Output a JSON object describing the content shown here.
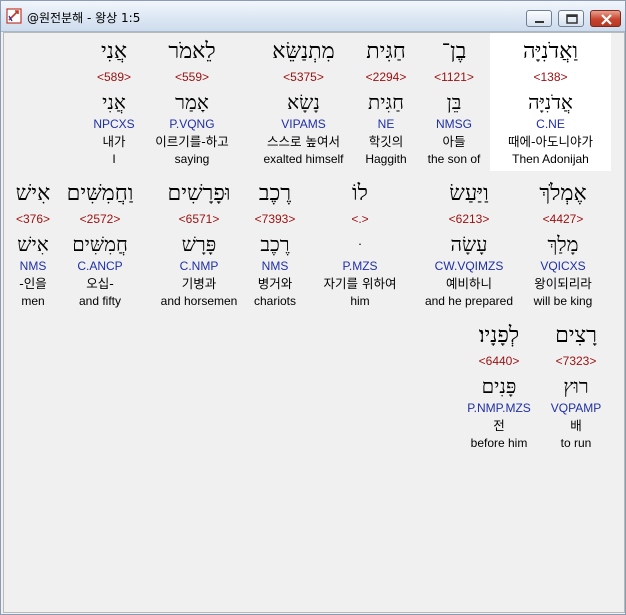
{
  "window": {
    "title": "@원전분해 - 왕상 1:5"
  },
  "rows": [
    [
      {
        "heb": "אֲנִי",
        "strong": "<589>",
        "lemma": "אֲנִי",
        "parse": "NPCXS",
        "kor": "내가",
        "eng": "I",
        "hl": false
      },
      {
        "heb": "לֵאמֹר",
        "strong": "<559>",
        "lemma": "אָמַר",
        "parse": "P.VQNG",
        "kor": "이르기를-하고",
        "eng": "saying",
        "hl": false
      },
      {
        "heb": "מִתְנַשֵּׂא",
        "strong": "<5375>",
        "lemma": "נָשָׂא",
        "parse": "VIPAMS",
        "kor": "스스로 높여서",
        "eng": "exalted himself",
        "hl": false
      },
      {
        "heb": "חַגִּית",
        "strong": "<2294>",
        "lemma": "חַגִּית",
        "parse": "NE",
        "kor": "학깃의",
        "eng": "Haggith",
        "hl": false
      },
      {
        "heb": "בֶן־",
        "strong": "<1121>",
        "lemma": "בֵּן",
        "parse": "NMSG",
        "kor": "아들",
        "eng": "the son of",
        "hl": false
      },
      {
        "heb": "וַאֲדֹנִיָּה",
        "strong": "<138>",
        "lemma": "אֲדֹנִיָּה",
        "parse": "C.NE",
        "kor": "때에-아도니야가",
        "eng": "Then Adonijah",
        "hl": true
      }
    ],
    [
      {
        "heb": "אִישׁ",
        "strong": "<376>",
        "lemma": "אִישׁ",
        "parse": "NMS",
        "kor": "-인을",
        "eng": "men",
        "hl": false
      },
      {
        "heb": "וַחֲמִשִּׁים",
        "strong": "<2572>",
        "lemma": "חֲמִשִּׁים",
        "parse": "C.ANCP",
        "kor": "오십-",
        "eng": "and fifty",
        "hl": false
      },
      {
        "heb": "וּפָרָשִׁים",
        "strong": "<6571>",
        "lemma": "פָּרָשׁ",
        "parse": "C.NMP",
        "kor": "기병과",
        "eng": "and horsemen",
        "hl": false
      },
      {
        "heb": "רֶכֶב",
        "strong": "<7393>",
        "lemma": "רֶכֶב",
        "parse": "NMS",
        "kor": "병거와",
        "eng": "chariots",
        "hl": false
      },
      {
        "heb": "לוֹ",
        "strong": "<.>",
        "lemma": "ּ",
        "parse": "P.MZS",
        "kor": "자기를 위하여",
        "eng": "him",
        "hl": false
      },
      {
        "heb": "וַיַּעַשׂ",
        "strong": "<6213>",
        "lemma": "עָשָׂה",
        "parse": "CW.VQIMZS",
        "kor": "예비하니",
        "eng": "and he prepared",
        "hl": false
      },
      {
        "heb": "אֶמְלֹךְ",
        "strong": "<4427>",
        "lemma": "מָלַךְ",
        "parse": "VQICXS",
        "kor": "왕이되리라",
        "eng": "will be king",
        "hl": false
      }
    ],
    [
      {
        "heb": "לְפָנָיו׃",
        "strong": "<6440>",
        "lemma": "פָּנִים",
        "parse": "P.NMP.MZS",
        "kor": "전",
        "eng": "before him",
        "hl": false
      },
      {
        "heb": "רָצִים",
        "strong": "<7323>",
        "lemma": "רוּץ",
        "parse": "VQPAMP",
        "kor": "배",
        "eng": "to run",
        "hl": false
      }
    ]
  ]
}
